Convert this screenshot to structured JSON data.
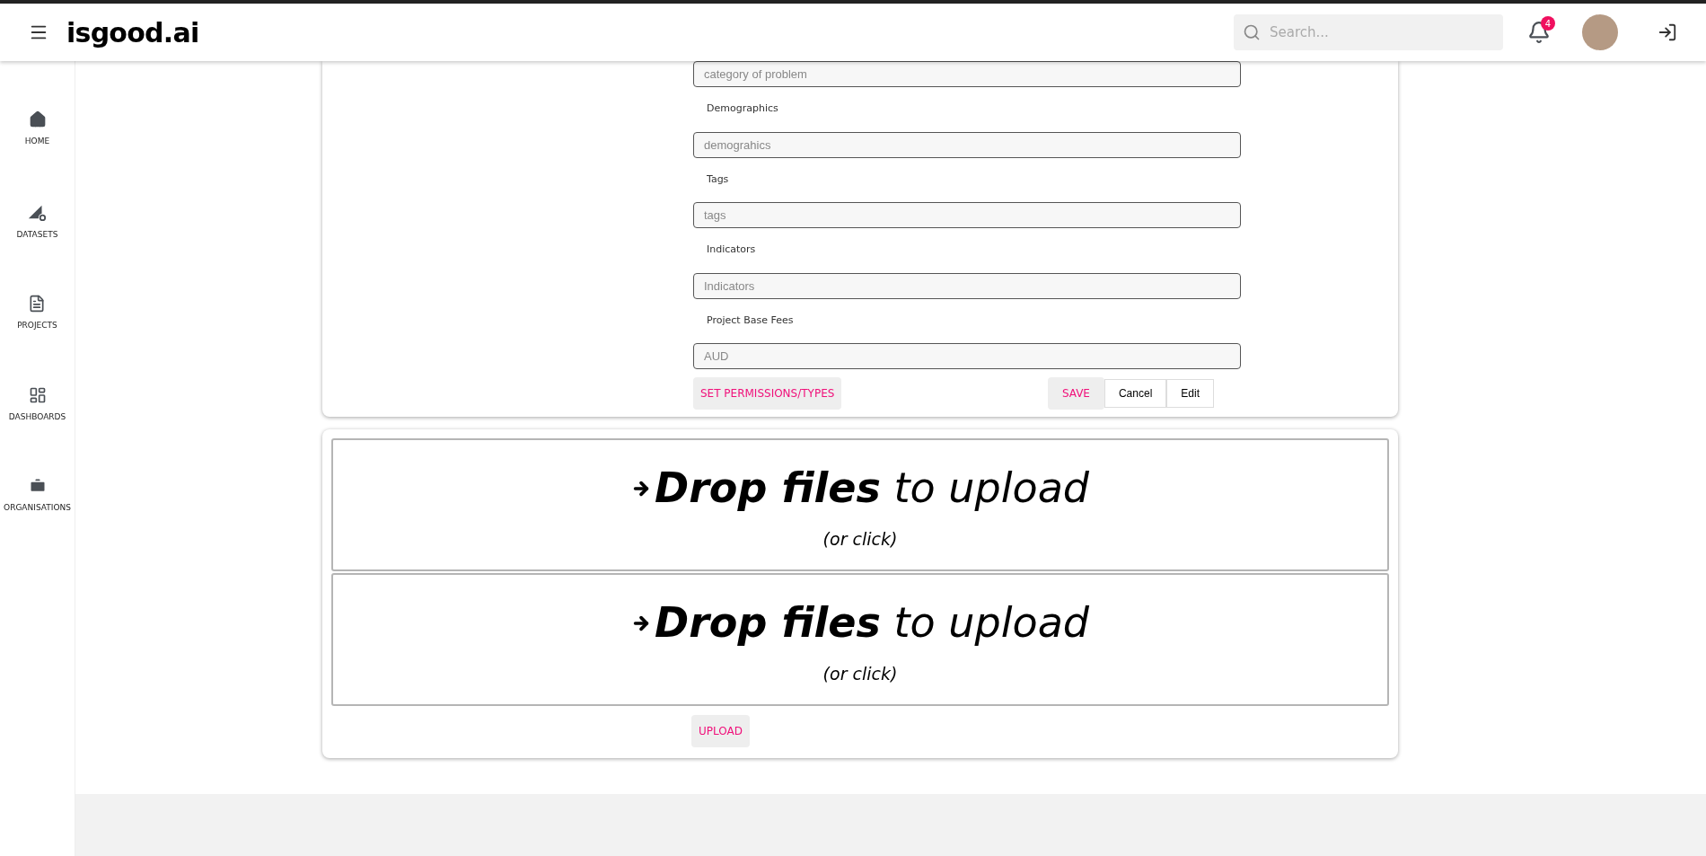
{
  "header": {
    "logo": "isgood.ai",
    "search": {
      "placeholder": "Search..."
    },
    "notifications": {
      "count": "4"
    }
  },
  "sidebar": {
    "items": [
      {
        "label": "HOME",
        "kind": "home"
      },
      {
        "label": "DATASETS",
        "kind": "datasets"
      },
      {
        "label": "PROJECTS",
        "kind": "projects"
      },
      {
        "label": "DASHBOARDS",
        "kind": "dashboards"
      },
      {
        "label": "ORGANISATIONS",
        "kind": "organisations"
      }
    ]
  },
  "form": {
    "fields": [
      {
        "placeholder": "category of problem"
      },
      {
        "label": "Demographics",
        "placeholder": "demograhics"
      },
      {
        "label": "Tags",
        "placeholder": "tags"
      },
      {
        "label": "Indicators",
        "placeholder": "Indicators"
      },
      {
        "label": "Project Base Fees",
        "placeholder": "AUD"
      }
    ],
    "permissions_button": "SET PERMISSIONS/TYPES",
    "save_button": "SAVE",
    "cancel_button": "Cancel",
    "edit_button": "Edit"
  },
  "upload": {
    "dropzones": [
      {
        "title": "**Drop files** to upload",
        "hint": "(or click)"
      },
      {
        "title": "**Drop files** to upload",
        "hint": "(or click)"
      }
    ],
    "upload_button": "UPLOAD"
  }
}
